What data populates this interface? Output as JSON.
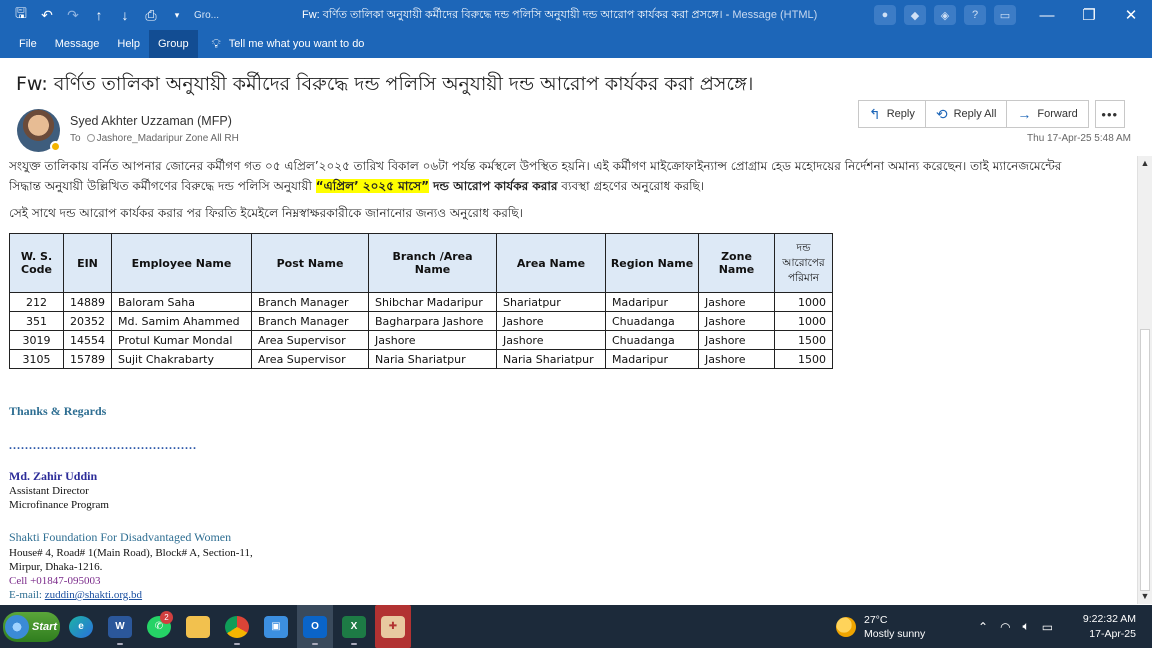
{
  "window": {
    "qat_group": "Gro...",
    "title": "Fw: বর্ণিত তালিকা অনুযায়ী কর্মীদের বিরুদ্ধে দন্ড পলিসি অনুযায়ী দন্ড আরোপ কার্যকর করা প্রসঙ্গে। -",
    "title_suffix": "Message (HTML)"
  },
  "ribbon": {
    "tabs": [
      "File",
      "Message",
      "Help",
      "Group"
    ],
    "active_tab": "Group",
    "tell_me": "Tell me what you want to do"
  },
  "email": {
    "subject": "Fw: বর্ণিত তালিকা অনুযায়ী কর্মীদের বিরুদ্ধে দন্ড পলিসি অনুযায়ী দন্ড আরোপ কার্যকর করা প্রসঙ্গে।",
    "sender": "Syed Akhter Uzzaman (MFP)",
    "to_label": "To",
    "to_value": "Jashore_Madaripur Zone All RH",
    "datetime": "Thu 17-Apr-25 5:48 AM",
    "actions": {
      "reply": "Reply",
      "reply_all": "Reply All",
      "forward": "Forward"
    }
  },
  "body": {
    "para1_line1": "সংযুক্ত তালিকায় বর্নিত আপনার জোনের কর্মীগণ গত ০৫ এপ্রিল’২০২৫ তারিখ বিকাল ০৬টা পর্যন্ত কর্মস্থলে উপস্থিত হয়নি। এই কর্মীগণ মাইক্রোফাইন্যান্স প্রোগ্রাম হেড মহোদয়ের নির্দেশনা অমান্য করেছেন। তাই ম্যানেজমেন্টের",
    "para1_line2_a": "সিদ্ধান্ত অনুযায়ী উল্লিখিত কর্মীগণের বিরুদ্ধে দন্ড পলিসি অনুযায়ী ",
    "para1_line2_hl": "“এপ্রিল’ ২০২৫ মাসে”",
    "para1_line2_bold": " দন্ড আরোপ কার্যকর করার",
    "para1_line2_c": " ব্যবস্থা গ্রহণের অনুরোধ করছি।",
    "para2": "সেই সাথে দন্ড আরোপ কার্যকর করার পর ফিরতি ইমেইলে নিম্নস্বাক্ষরকারীকে জানানোর জন্যও অনুরোধ করছি।"
  },
  "table": {
    "headers": [
      "W. S. Code",
      "EIN",
      "Employee Name",
      "Post Name",
      "Branch /Area Name",
      "Area Name",
      "Region Name",
      "Zone Name",
      "দন্ড আরোপের পরিমান"
    ],
    "rows": [
      [
        "212",
        "14889",
        "Baloram Saha",
        "Branch Manager",
        "Shibchar  Madaripur",
        "Shariatpur",
        "Madaripur",
        "Jashore",
        "1000"
      ],
      [
        "351",
        "20352",
        "Md. Samim Ahammed",
        "Branch Manager",
        "Bagharpara  Jashore",
        "Jashore",
        "Chuadanga",
        "Jashore",
        "1000"
      ],
      [
        "3019",
        "14554",
        "Protul Kumar Mondal",
        "Area Supervisor",
        "Jashore",
        "Jashore",
        "Chuadanga",
        "Jashore",
        "1500"
      ],
      [
        "3105",
        "15789",
        "Sujit Chakrabarty",
        "Area Supervisor",
        "Naria Shariatpur",
        "Naria Shariatpur",
        "Madaripur",
        "Jashore",
        "1500"
      ]
    ]
  },
  "signature": {
    "thanks": "Thanks & Regards",
    "dots": "...............................................",
    "name": "Md. Zahir Uddin",
    "title": "Assistant Director",
    "program": "Microfinance Program",
    "org": "Shakti Foundation For Disadvantaged Women",
    "address1": "House# 4, Road# 1(Main Road), Block# A, Section-11,",
    "address2": "Mirpur, Dhaka-1216.",
    "cell": "Cell +01847-095003",
    "email_label": "E-mail: ",
    "email": "zuddin@shakti.org.bd"
  },
  "taskbar": {
    "start_label": "Start",
    "whatsapp_badge": "2",
    "weather_temp": "27°C",
    "weather_desc": "Mostly sunny",
    "time": "9:22:32 AM",
    "date": "17-Apr-25"
  }
}
